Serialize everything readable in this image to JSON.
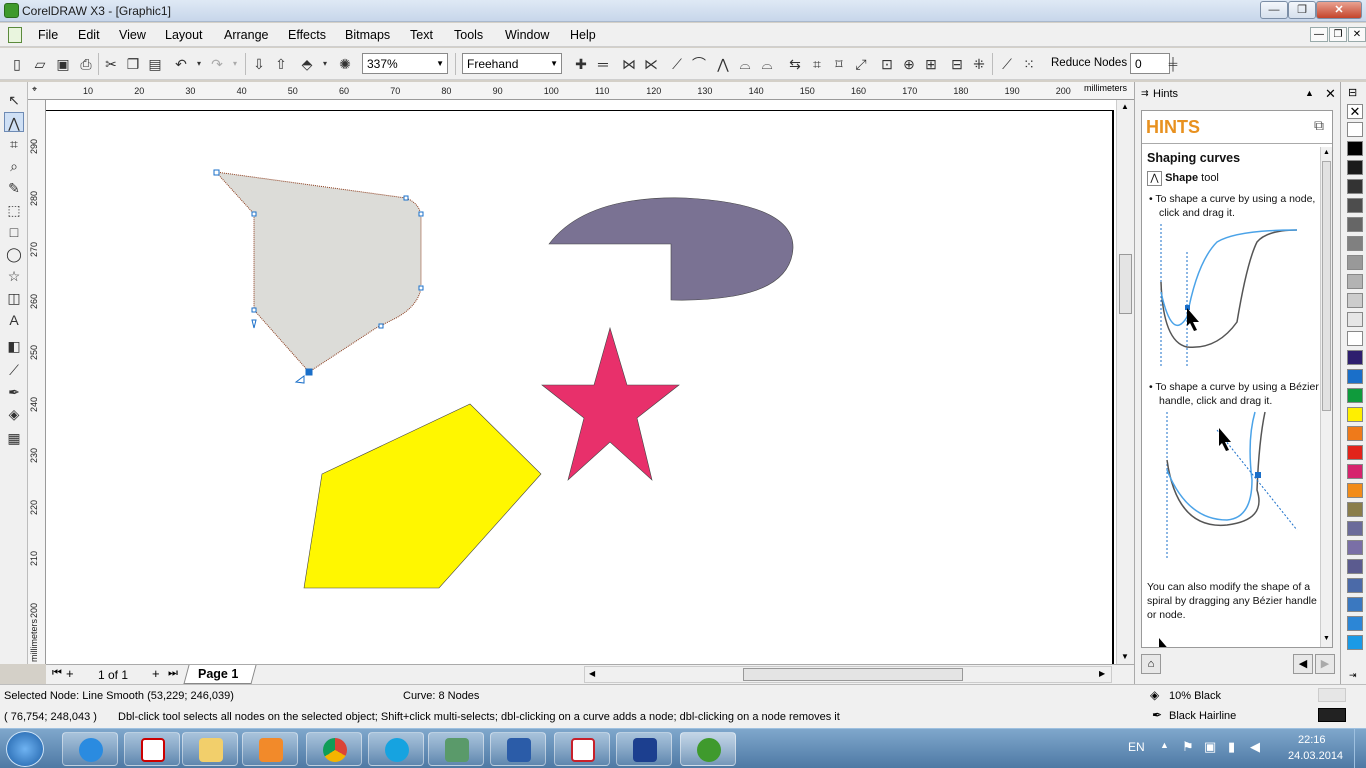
{
  "window": {
    "title": "CorelDRAW X3 - [Graphic1]",
    "controls": [
      "—",
      "❐",
      "✕"
    ]
  },
  "menu": {
    "items": [
      "File",
      "Edit",
      "View",
      "Layout",
      "Arrange",
      "Effects",
      "Bitmaps",
      "Text",
      "Tools",
      "Window",
      "Help"
    ],
    "mdi_controls": [
      "—",
      "❐",
      "✕"
    ]
  },
  "toolbar": {
    "zoom_value": "337%",
    "curve_style_value": "Freehand",
    "reduce_nodes_label": "Reduce Nodes",
    "reduce_nodes_value": "0"
  },
  "rulers": {
    "unit": "millimeters",
    "h_ticks": [
      "10",
      "20",
      "30",
      "40",
      "50",
      "60",
      "70",
      "80",
      "90",
      "100",
      "110",
      "120",
      "130",
      "140",
      "150",
      "160",
      "170",
      "180",
      "190",
      "200"
    ],
    "v_ticks": [
      "290",
      "280",
      "270",
      "260",
      "250",
      "240",
      "230",
      "220",
      "210",
      "200"
    ]
  },
  "page_nav": {
    "page_count_text": "1 of 1",
    "page_tab_label": "Page 1"
  },
  "docker": {
    "header_label": "Hints",
    "hints_title": "HINTS",
    "section_title": "Shaping curves",
    "tool_name": "Shape",
    "tool_suffix": "tool",
    "bullet1": "To shape a curve by using a node, click and drag it.",
    "bullet2": "To shape a curve by using a Bézier handle, click and drag it.",
    "paragraph": "You can also modify the shape of a spiral by dragging any Bézier handle or node."
  },
  "status": {
    "selected_node": "Selected Node: Line Smooth (53,229; 246,039)",
    "curve_info": "Curve: 8 Nodes",
    "cursor_coords": "( 76,754; 248,043 )",
    "hint_text": "Dbl-click tool selects all nodes on the selected object; Shift+click multi-selects; dbl-clicking on a curve adds a node; dbl-clicking on a node removes it",
    "fill_label": "10% Black",
    "outline_label": "Black  Hairline"
  },
  "colors": {
    "shape_gray": "#dcdcd8",
    "shape_purple": "#7a7293",
    "shape_pink": "#e8306b",
    "shape_yellow": "#fff700",
    "hints_orange": "#e8911f"
  },
  "palette": [
    "#ffffff",
    "#000000",
    "#1a1a1a",
    "#333333",
    "#4d4d4d",
    "#666666",
    "#808080",
    "#999999",
    "#b3b3b3",
    "#cccccc",
    "#e6e6e6",
    "#ffffff",
    "#2e1f6e",
    "#1a6fc9",
    "#0f9b3c",
    "#ffef00",
    "#ef7a1a",
    "#e2231a",
    "#d6246d",
    "#f28c1a",
    "#8a7d4a",
    "#6b6b9a",
    "#7a6fa6",
    "#5b5b8f",
    "#4b6aa8",
    "#3a78c0",
    "#2c86d6",
    "#1a9ae6"
  ],
  "taskbar": {
    "lang": "EN",
    "time": "22:16",
    "date": "24.03.2014"
  }
}
